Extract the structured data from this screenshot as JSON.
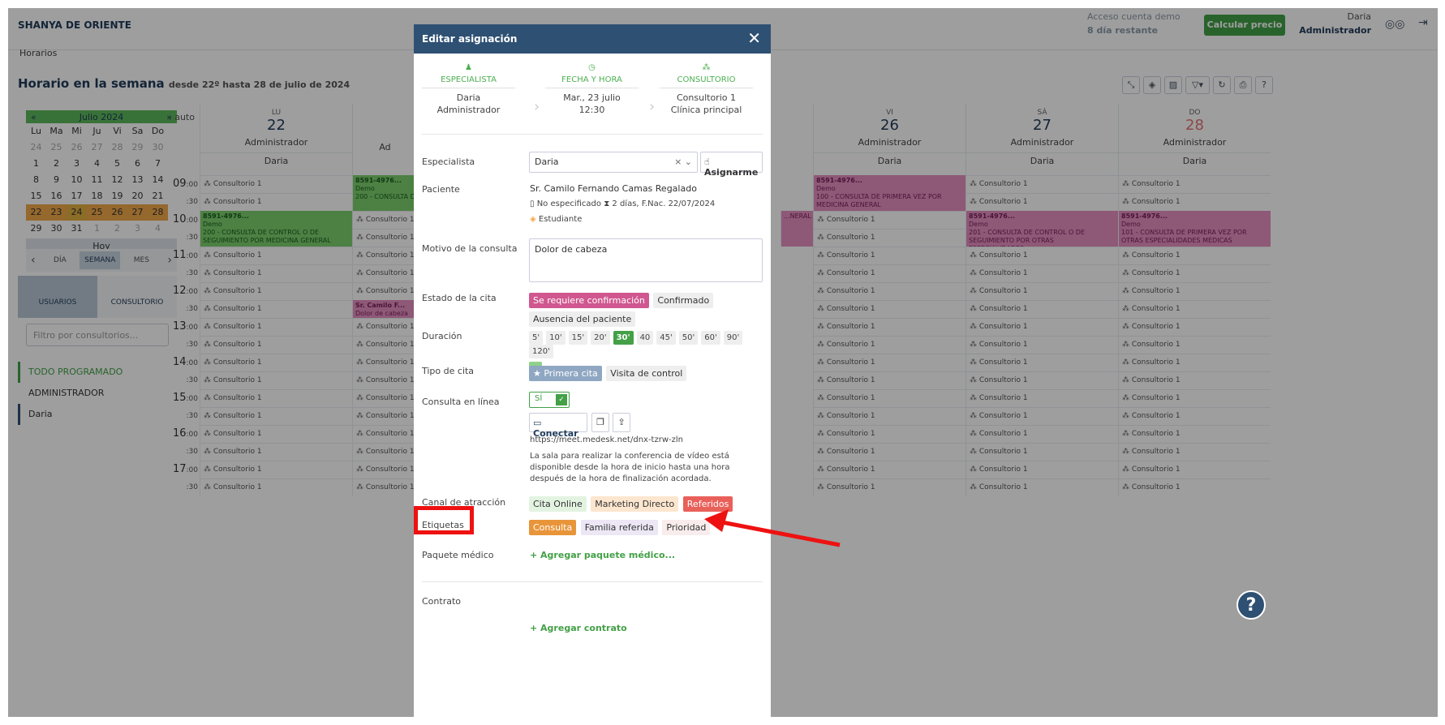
{
  "header": {
    "brand": "SHANYA DE ORIENTE",
    "demo_line1": "Acceso cuenta demo",
    "demo_line2": "8 día restante",
    "calc_button": "Calcular precio",
    "user_name": "Daria",
    "user_role": "Administrador"
  },
  "breadcrumb": "Horarios",
  "page": {
    "title": "Horario en la semana",
    "subtitle": "desde 22º hasta 28 de julio de 2024"
  },
  "toolbar_icons": [
    "expand-icon",
    "layers-icon",
    "hide-icon",
    "filter-icon",
    "refresh-icon",
    "print-icon",
    "help-icon"
  ],
  "minical": {
    "prev": "«",
    "month": "Julio 2024",
    "next": "»",
    "weekdays": [
      "Lu",
      "Ma",
      "Mi",
      "Ju",
      "Vi",
      "Sa",
      "Do"
    ],
    "days": [
      "24",
      "25",
      "26",
      "27",
      "28",
      "29",
      "30",
      "1",
      "2",
      "3",
      "4",
      "5",
      "6",
      "7",
      "8",
      "9",
      "10",
      "11",
      "12",
      "13",
      "14",
      "15",
      "16",
      "17",
      "18",
      "19",
      "20",
      "21",
      "22",
      "23",
      "24",
      "25",
      "26",
      "27",
      "28",
      "29",
      "30",
      "31",
      "1",
      "2",
      "3",
      "4"
    ],
    "today": "Hoy"
  },
  "views": {
    "day": "DÍA",
    "week": "SEMANA",
    "month": "MES"
  },
  "modes": {
    "users": "USUARIOS",
    "office": "CONSULTORIO"
  },
  "office_filter_placeholder": "Filtro por consultorios...",
  "userlist": {
    "all": "TODO PROGRAMADO",
    "admin": "ADMINISTRADOR",
    "daria": "Daria"
  },
  "calendar": {
    "auto": ": auto",
    "days": [
      {
        "wd": "LU",
        "num": "22",
        "admin": "Administrador",
        "doc": "Daria"
      },
      {
        "wd": "VI",
        "num": "26",
        "admin": "Administrador",
        "doc": "Daria"
      },
      {
        "wd": "SÁ",
        "num": "27",
        "admin": "Administrador",
        "doc": "Daria"
      },
      {
        "wd": "DO",
        "num": "28",
        "admin": "Administrador",
        "doc": "Daria"
      }
    ],
    "partial_admin": "Ad",
    "hours": [
      "09",
      "10",
      "11",
      "12",
      "13",
      "14",
      "15",
      "16",
      "17"
    ],
    "half": ":30",
    "min00": ":00",
    "slot_label": "Consultorio 1",
    "events": {
      "mon10_id": "8591-4976...",
      "mon10_demo": "Demo",
      "mon10_desc": "200 - CONSULTA DE CONTROL O DE SEGUIMIENTO POR MEDICINA GENERAL",
      "tue09_id": "8591-4976...",
      "tue09_demo": "Demo",
      "tue09_desc": "200 - CONSULTA D... SEGUIMIENTO PO...",
      "tue1230_name": "Sr. Camilo F...",
      "tue1230_reason": "Dolor de cabeza",
      "fri09_id": "8591-4976...",
      "fri09_demo": "Demo",
      "fri09_desc": "100 - CONSULTA DE PRIMERA VEZ POR MEDICINA GENERAL",
      "sat10_id": "8591-4976...",
      "sat10_demo": "Demo",
      "sat10_desc": "201 - CONSULTA DE CONTROL O DE SEGUIMIENTO POR OTRAS ESPECIALIDADES...",
      "sun10_id": "8591-4976...",
      "sun10_demo": "Demo",
      "sun10_desc": "101 - CONSULTA DE PRIMERA VEZ POR OTRAS ESPECIALIDADES MÉDICAS",
      "thu10_tail": "...NERAL"
    }
  },
  "modal": {
    "title": "Editar asignación",
    "close": "✕",
    "steps": [
      {
        "label": "ESPECIALISTA",
        "v1": "Daria",
        "v2": "Administrador"
      },
      {
        "label": "FECHA Y HORA",
        "v1": "Mar., 23 julio",
        "v2": "12:30"
      },
      {
        "label": "CONSULTORIO",
        "v1": "Consultorio 1",
        "v2": "Clínica principal"
      }
    ],
    "specialist_label": "Especialista",
    "specialist_value": "Daria",
    "assign_me": "Asignarme",
    "patient_label": "Paciente",
    "patient_name": "Sr. Camilo Fernando Camas Regalado",
    "patient_gender": "No especificado",
    "patient_age": "2 días, F.Nac. 22/07/2024",
    "patient_tag": "Estudiante",
    "reason_label": "Motivo de la consulta",
    "reason_value": "Dolor de cabeza",
    "status_label": "Estado de la cita",
    "status_options": [
      "Se requiere confirmación",
      "Confirmado",
      "Ausencia del paciente"
    ],
    "duration_label": "Duración",
    "durations": [
      "5'",
      "10'",
      "15'",
      "20'",
      "30'",
      "40",
      "45'",
      "50'",
      "60'",
      "90'",
      "120'"
    ],
    "duration_plus": "+",
    "type_label": "Tipo de cita",
    "type_options": [
      "★ Primera cita",
      "Visita de control"
    ],
    "online_label": "Consulta en línea",
    "online_toggle": "SÍ",
    "connect": "Conectar",
    "meet_url": "https://meet.medesk.net/dnx-tzrw-zln",
    "meet_note": "La sala para realizar la conferencia de vídeo está disponible desde la hora de inicio hasta una hora después de la hora de finalización acordada.",
    "channel_label": "Canal de atracción",
    "channels": [
      "Cita Online",
      "Marketing Directo",
      "Referidos"
    ],
    "tags_label": "Etiquetas",
    "tags": [
      "Consulta",
      "Familia referida",
      "Prioridad"
    ],
    "package_label": "Paquete médico",
    "add_package": "+ Agregar paquete médico...",
    "contract_label": "Contrato",
    "add_contract": "+ Agregar contrato"
  },
  "colors": {
    "accent": "#43a047",
    "header": "#2e5073",
    "highlight": "#ee1111"
  },
  "help_button": "?"
}
